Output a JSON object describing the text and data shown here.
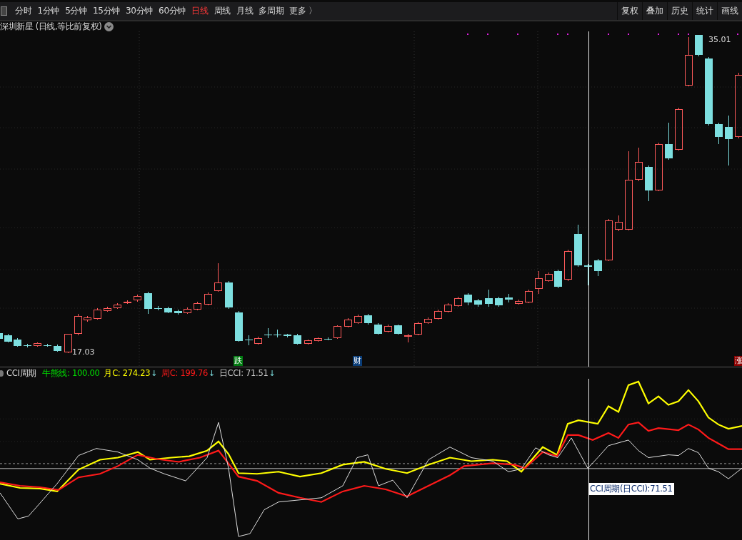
{
  "toolbar": {
    "tabs": [
      {
        "label": "分时",
        "selected": false
      },
      {
        "label": "1分钟",
        "selected": false
      },
      {
        "label": "5分钟",
        "selected": false
      },
      {
        "label": "15分钟",
        "selected": false
      },
      {
        "label": "30分钟",
        "selected": false
      },
      {
        "label": "60分钟",
        "selected": false
      },
      {
        "label": "日线",
        "selected": true
      },
      {
        "label": "周线",
        "selected": false
      },
      {
        "label": "月线",
        "selected": false
      },
      {
        "label": "多周期",
        "selected": false
      },
      {
        "label": "更多 〉",
        "selected": false
      }
    ],
    "buttons": [
      "复权",
      "叠加",
      "历史",
      "统计",
      "画线"
    ]
  },
  "chart": {
    "title": "深圳新星 (日线,等比前复权)",
    "high_label": "35.01",
    "low_label": "17.03",
    "markers": [
      {
        "text": "跌",
        "color": "#007a10"
      },
      {
        "text": "财",
        "color": "#0a3d78"
      },
      {
        "text": "涨",
        "color": "#8a0000"
      }
    ]
  },
  "indicator": {
    "name": "CCI周期",
    "items": [
      {
        "text": "牛熊线: 100.00",
        "color": "#00e000"
      },
      {
        "text": "月C: 274.23",
        "color": "#ffff00",
        "arrow": "↓"
      },
      {
        "text": "周C: 199.76",
        "color": "#ff1a1a",
        "arrow": "↓"
      },
      {
        "text": "日CCI: 71.51",
        "color": "#c8c8c8",
        "arrow": "↓"
      }
    ],
    "tooltip": "CCI周期(日CCI):71.51"
  }
}
